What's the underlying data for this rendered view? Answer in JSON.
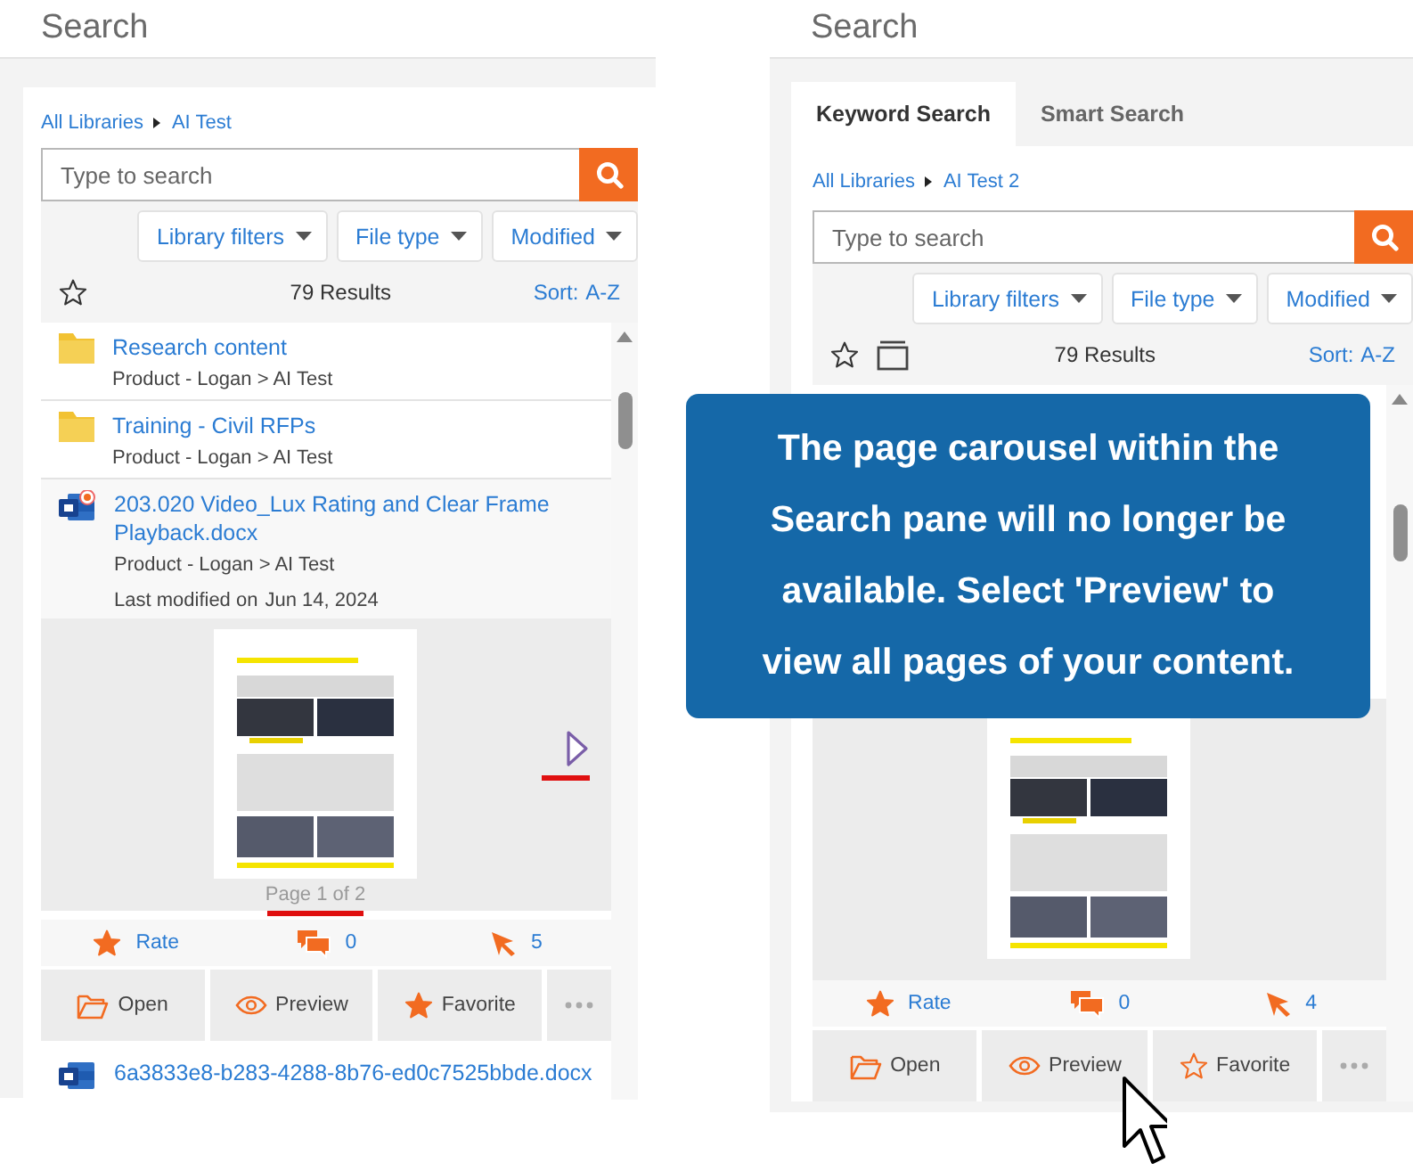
{
  "panes": [
    {
      "title": "Search",
      "breadcrumb": [
        "All Libraries",
        "AI Test"
      ],
      "search": {
        "placeholder": "Type to search"
      },
      "filters": [
        "Library filters",
        "File type",
        "Modified"
      ],
      "show_layout_icon": false,
      "results": "79 Results",
      "sort_label": "Sort:",
      "sort_value": "A-Z",
      "list_gap": false,
      "items": [
        {
          "kind": "folder",
          "title": "Research content",
          "path": "Product - Logan > AI Test"
        },
        {
          "kind": "folder",
          "title": "Training - Civil RFPs",
          "path": "Product - Logan > AI Test"
        },
        {
          "kind": "document",
          "title": "203.020 Video_Lux Rating and Clear Frame Playback.docx",
          "path": "Product - Logan > AI Test",
          "modified_label": "Last modified on",
          "modified_date": "Jun 14, 2024",
          "favorite_badge": true,
          "preview": {
            "page_label": "Page 1 of 2",
            "has_next": true,
            "marked": true
          },
          "stats": {
            "rate": "Rate",
            "comments": "0",
            "views": "5"
          },
          "actions": [
            {
              "kind": "open",
              "label": "Open"
            },
            {
              "kind": "preview",
              "label": "Preview"
            },
            {
              "kind": "favorite",
              "label": "Favorite",
              "on": true
            },
            {
              "kind": "more"
            }
          ]
        },
        {
          "kind": "file",
          "title": "6a3833e8-b283-4288-8b76-ed0c7525bbde.docx",
          "favorite_badge": false
        }
      ]
    },
    {
      "title": "Search",
      "tabs": [
        {
          "label": "Keyword Search",
          "selected": true
        },
        {
          "label": "Smart Search",
          "selected": false
        }
      ],
      "breadcrumb": [
        "All Libraries",
        "AI Test 2"
      ],
      "search": {
        "placeholder": "Type to search"
      },
      "filters": [
        "Library filters",
        "File type",
        "Modified"
      ],
      "show_layout_icon": true,
      "results": "79 Results",
      "sort_label": "Sort:",
      "sort_value": "A-Z",
      "list_gap": true,
      "items": [
        {
          "kind": "preview_only",
          "preview": {
            "has_next": false
          },
          "stats": {
            "rate": "Rate",
            "comments": "0",
            "views": "4"
          },
          "actions": [
            {
              "kind": "open",
              "label": "Open"
            },
            {
              "kind": "preview",
              "label": "Preview"
            },
            {
              "kind": "favorite",
              "label": "Favorite",
              "on": false
            },
            {
              "kind": "more"
            }
          ]
        }
      ]
    }
  ],
  "callout": {
    "text": "The page carousel within the Search pane will no longer be available. Select 'Preview' to view all pages of your content."
  },
  "pointer": {
    "visible": true
  }
}
